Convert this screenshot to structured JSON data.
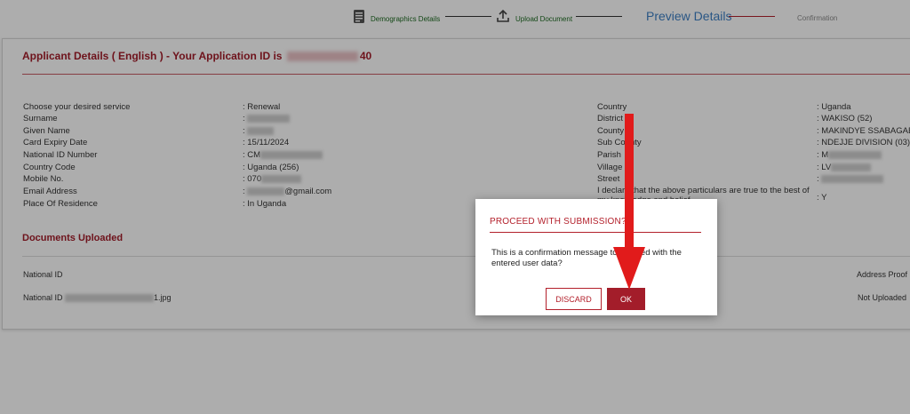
{
  "stepper": {
    "steps": [
      {
        "label": "Demographics Details"
      },
      {
        "label": "Upload Document"
      },
      {
        "label": "Preview Details"
      },
      {
        "label": "Confirmation"
      }
    ]
  },
  "applicant": {
    "title": "Applicant Details ( English )  -  Your Application ID is",
    "app_id_suffix": "40",
    "left_fields": [
      {
        "label": "Choose your desired service",
        "value": ": Renewal"
      },
      {
        "label": "Surname",
        "value": ":"
      },
      {
        "label": "Given Name",
        "value": ":"
      },
      {
        "label": "Card Expiry Date",
        "value": ": 15/11/2024"
      },
      {
        "label": "National ID Number",
        "value": ": CM"
      },
      {
        "label": "Country Code",
        "value": ": Uganda (256)"
      },
      {
        "label": "Mobile No.",
        "value": ": 070"
      },
      {
        "label": "Email Address",
        "value": ":"
      },
      {
        "label": "Place Of Residence",
        "value": ": In Uganda"
      }
    ],
    "email_suffix": "@gmail.com",
    "right_fields": [
      {
        "label": "Country",
        "value": ": Uganda"
      },
      {
        "label": "District",
        "value": ": WAKISO (52)"
      },
      {
        "label": "County",
        "value": ": MAKINDYE SSABAGABO"
      },
      {
        "label": "Sub County",
        "value": ": NDEJJE DIVISION (03)"
      },
      {
        "label": "Parish",
        "value": ": M"
      },
      {
        "label": "Village",
        "value": ": LV"
      },
      {
        "label": "Street",
        "value": ":"
      }
    ],
    "declaration": {
      "label": "I declare that the above particulars are true to the best of my knowledge and belief",
      "value": ": Y"
    }
  },
  "documents": {
    "title": "Documents Uploaded",
    "col1_header": "National ID",
    "col1_value_prefix": "National ID",
    "col1_value_suffix": "1.jpg",
    "col2_header": "Address Proof",
    "col2_value": "Not Uploaded"
  },
  "modal": {
    "title": "PROCEED WITH SUBMISSION?",
    "message": "This is a confirmation message to proceed with the entered user data?",
    "discard_label": "DISCARD",
    "ok_label": "OK"
  },
  "colors": {
    "accent": "#a31d2a",
    "active_step": "#3d7fc4",
    "done_step": "#1e6b22"
  }
}
